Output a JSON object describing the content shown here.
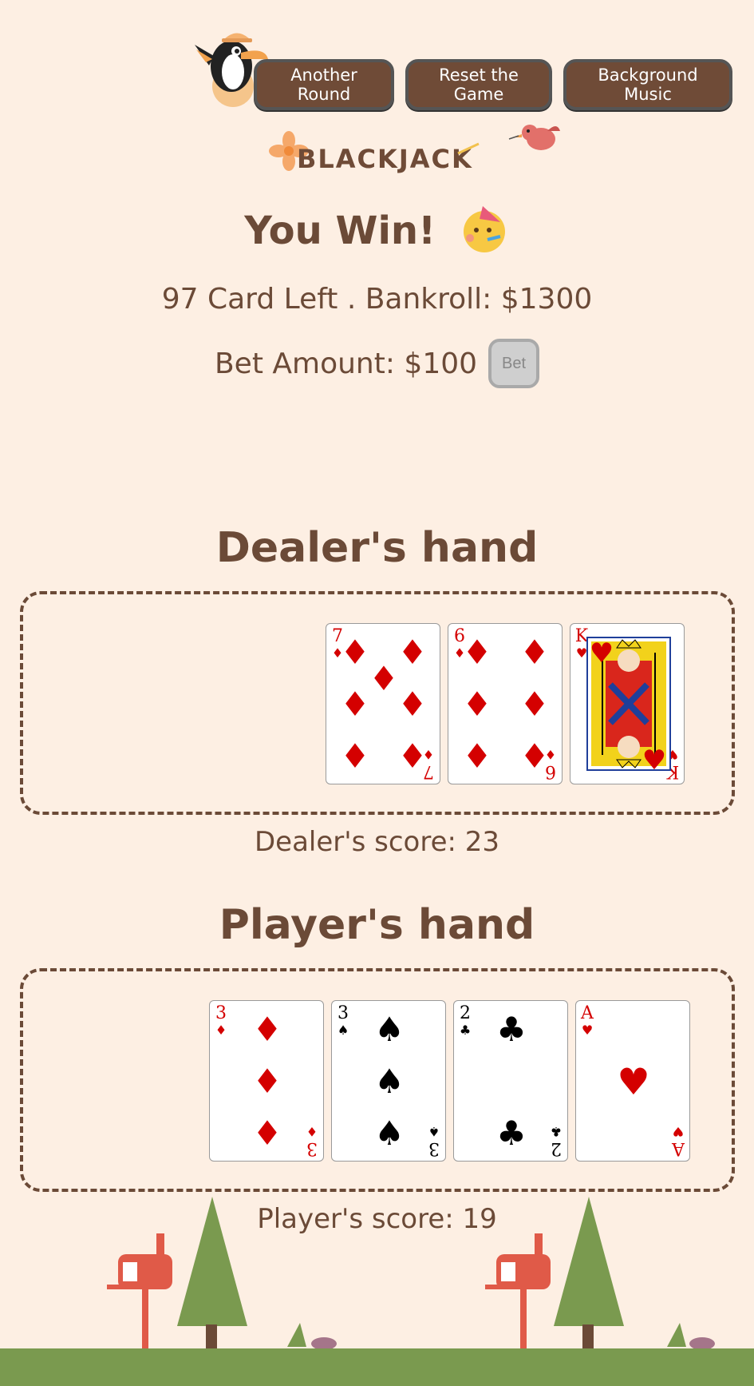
{
  "toolbar": {
    "another_round": "Another Round",
    "reset_game": "Reset the Game",
    "background_music": "Background Music"
  },
  "logo": {
    "text": "BLACKJACK"
  },
  "result": {
    "text": "You Win!",
    "emoji": "🥳"
  },
  "status": {
    "text": "97 Card Left . Bankroll: $1300"
  },
  "bet": {
    "label": "Bet Amount: $100",
    "button": "Bet"
  },
  "dealer": {
    "title": "Dealer's hand",
    "score": "Dealer's score: 23",
    "cards": [
      {
        "rank": "7",
        "suit": "♦",
        "color": "red"
      },
      {
        "rank": "6",
        "suit": "♦",
        "color": "red"
      },
      {
        "rank": "K",
        "suit": "♥",
        "color": "red"
      }
    ]
  },
  "player": {
    "title": "Player's hand",
    "score": "Player's score: 19",
    "cards": [
      {
        "rank": "3",
        "suit": "♦",
        "color": "red"
      },
      {
        "rank": "3",
        "suit": "♠",
        "color": "black"
      },
      {
        "rank": "2",
        "suit": "♣",
        "color": "black"
      },
      {
        "rank": "A",
        "suit": "♥",
        "color": "red"
      }
    ]
  },
  "colors": {
    "background": "#fdefe3",
    "brown": "#6b4a37",
    "button": "#6f4b37",
    "ground": "#7a9a4f",
    "tree": "#7a9a4f",
    "mailbox": "#e05a48"
  }
}
